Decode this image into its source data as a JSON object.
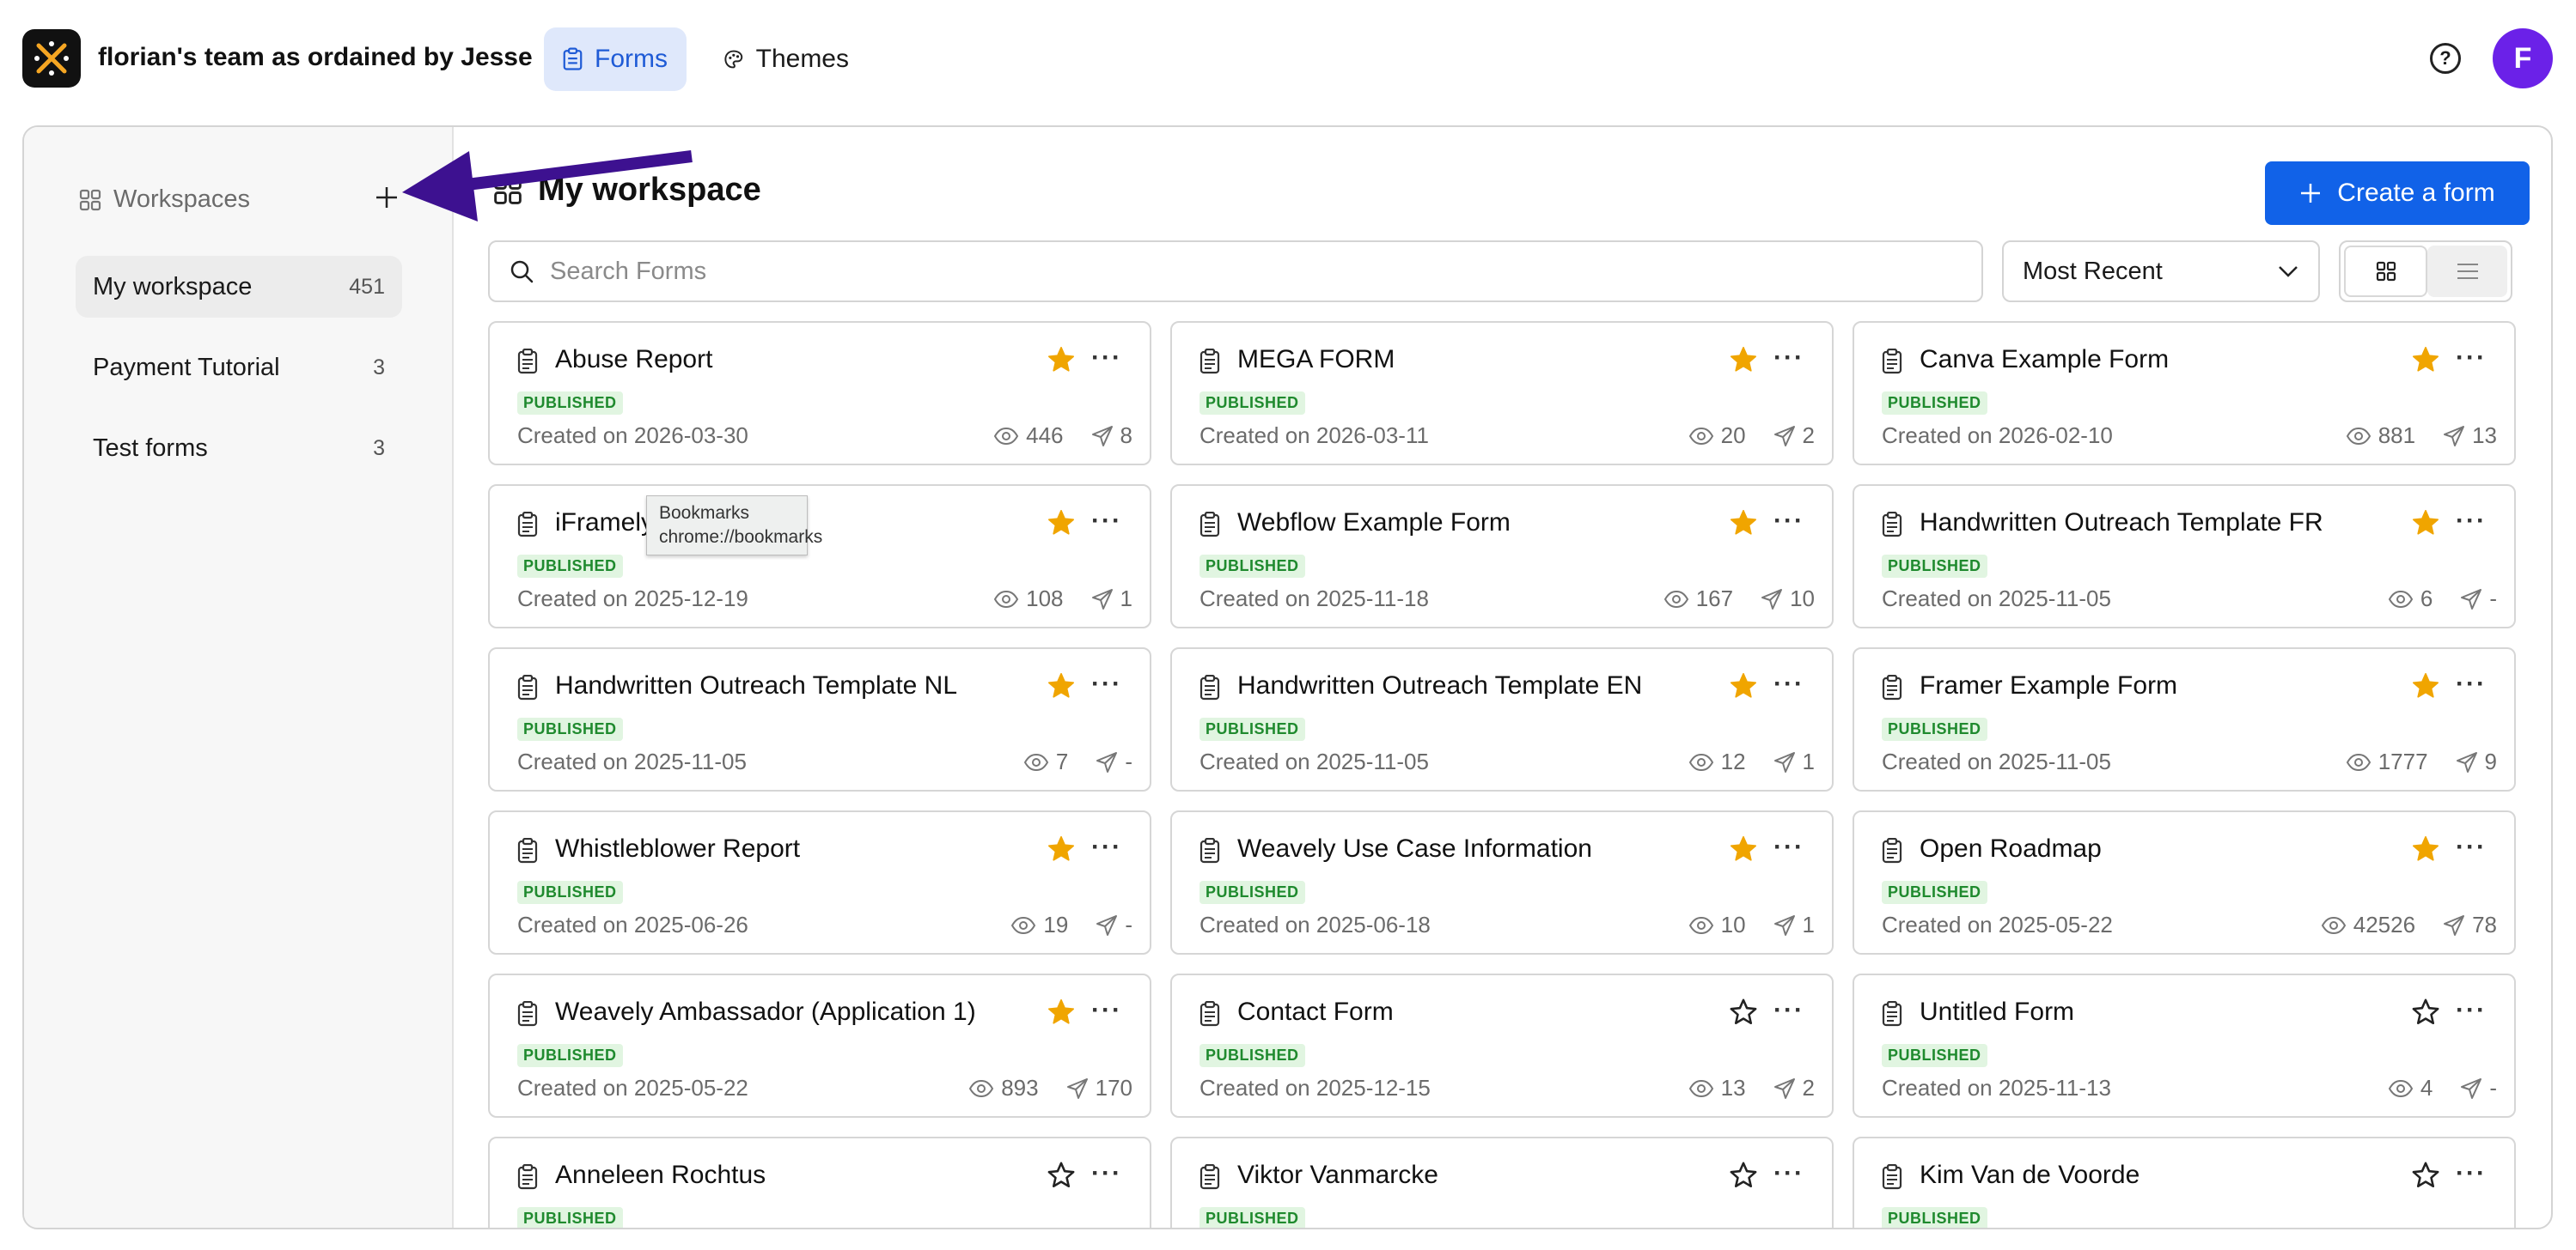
{
  "header": {
    "team_name": "florian's team as ordained by Jesse",
    "tabs": [
      {
        "label": "Forms",
        "icon": "clipboard-icon",
        "active": true
      },
      {
        "label": "Themes",
        "icon": "palette-icon",
        "active": false
      }
    ],
    "help_icon": "help-circle-icon",
    "avatar_initial": "F",
    "avatar_color": "#6b21e8"
  },
  "sidebar": {
    "header_label": "Workspaces",
    "items": [
      {
        "label": "My workspace",
        "count": "451",
        "active": true
      },
      {
        "label": "Payment Tutorial",
        "count": "3"
      },
      {
        "label": "Test forms",
        "count": "3"
      }
    ]
  },
  "main": {
    "title": "My workspace",
    "create_button": "Create a form",
    "search_placeholder": "Search Forms",
    "sort_selected": "Most Recent",
    "view_mode": "grid"
  },
  "forms": [
    {
      "title": "Abuse Report",
      "status": "PUBLISHED",
      "created": "Created on 2026-03-30",
      "views": "446",
      "responses": "8",
      "starred": true
    },
    {
      "title": "MEGA FORM",
      "status": "PUBLISHED",
      "created": "Created on 2026-03-11",
      "views": "20",
      "responses": "2",
      "starred": true
    },
    {
      "title": "Canva Example Form",
      "status": "PUBLISHED",
      "created": "Created on 2026-02-10",
      "views": "881",
      "responses": "13",
      "starred": true
    },
    {
      "title": "iFramely",
      "status": "PUBLISHED",
      "created": "Created on 2025-12-19",
      "views": "108",
      "responses": "1",
      "starred": true
    },
    {
      "title": "Webflow Example Form",
      "status": "PUBLISHED",
      "created": "Created on 2025-11-18",
      "views": "167",
      "responses": "10",
      "starred": true
    },
    {
      "title": "Handwritten Outreach Template FR",
      "status": "PUBLISHED",
      "created": "Created on 2025-11-05",
      "views": "6",
      "responses": "-",
      "starred": true
    },
    {
      "title": "Handwritten Outreach Template NL",
      "status": "PUBLISHED",
      "created": "Created on 2025-11-05",
      "views": "7",
      "responses": "-",
      "starred": true
    },
    {
      "title": "Handwritten Outreach Template EN",
      "status": "PUBLISHED",
      "created": "Created on 2025-11-05",
      "views": "12",
      "responses": "1",
      "starred": true
    },
    {
      "title": "Framer Example Form",
      "status": "PUBLISHED",
      "created": "Created on 2025-11-05",
      "views": "1777",
      "responses": "9",
      "starred": true
    },
    {
      "title": "Whistleblower Report",
      "status": "PUBLISHED",
      "created": "Created on 2025-06-26",
      "views": "19",
      "responses": "-",
      "starred": true
    },
    {
      "title": "Weavely Use Case Information",
      "status": "PUBLISHED",
      "created": "Created on 2025-06-18",
      "views": "10",
      "responses": "1",
      "starred": true
    },
    {
      "title": "Open Roadmap",
      "status": "PUBLISHED",
      "created": "Created on 2025-05-22",
      "views": "42526",
      "responses": "78",
      "starred": true
    },
    {
      "title": "Weavely Ambassador (Application 1)",
      "status": "PUBLISHED",
      "created": "Created on 2025-05-22",
      "views": "893",
      "responses": "170",
      "starred": true
    },
    {
      "title": "Contact Form",
      "status": "PUBLISHED",
      "created": "Created on 2025-12-15",
      "views": "13",
      "responses": "2",
      "starred": false
    },
    {
      "title": "Untitled Form",
      "status": "PUBLISHED",
      "created": "Created on 2025-11-13",
      "views": "4",
      "responses": "-",
      "starred": false
    },
    {
      "title": "Anneleen Rochtus",
      "status": "PUBLISHED",
      "starred": false
    },
    {
      "title": "Viktor Vanmarcke",
      "status": "PUBLISHED",
      "starred": false
    },
    {
      "title": "Kim Van de Voorde",
      "status": "PUBLISHED",
      "starred": false
    }
  ],
  "tooltip": {
    "line1": "Bookmarks",
    "line2": "chrome://bookmarks"
  },
  "colors": {
    "accent": "#1162e8",
    "star": "#f0a500",
    "published_bg": "#e1f5e1",
    "published_text": "#1f8a2e",
    "annotation_arrow": "#3d1190"
  }
}
